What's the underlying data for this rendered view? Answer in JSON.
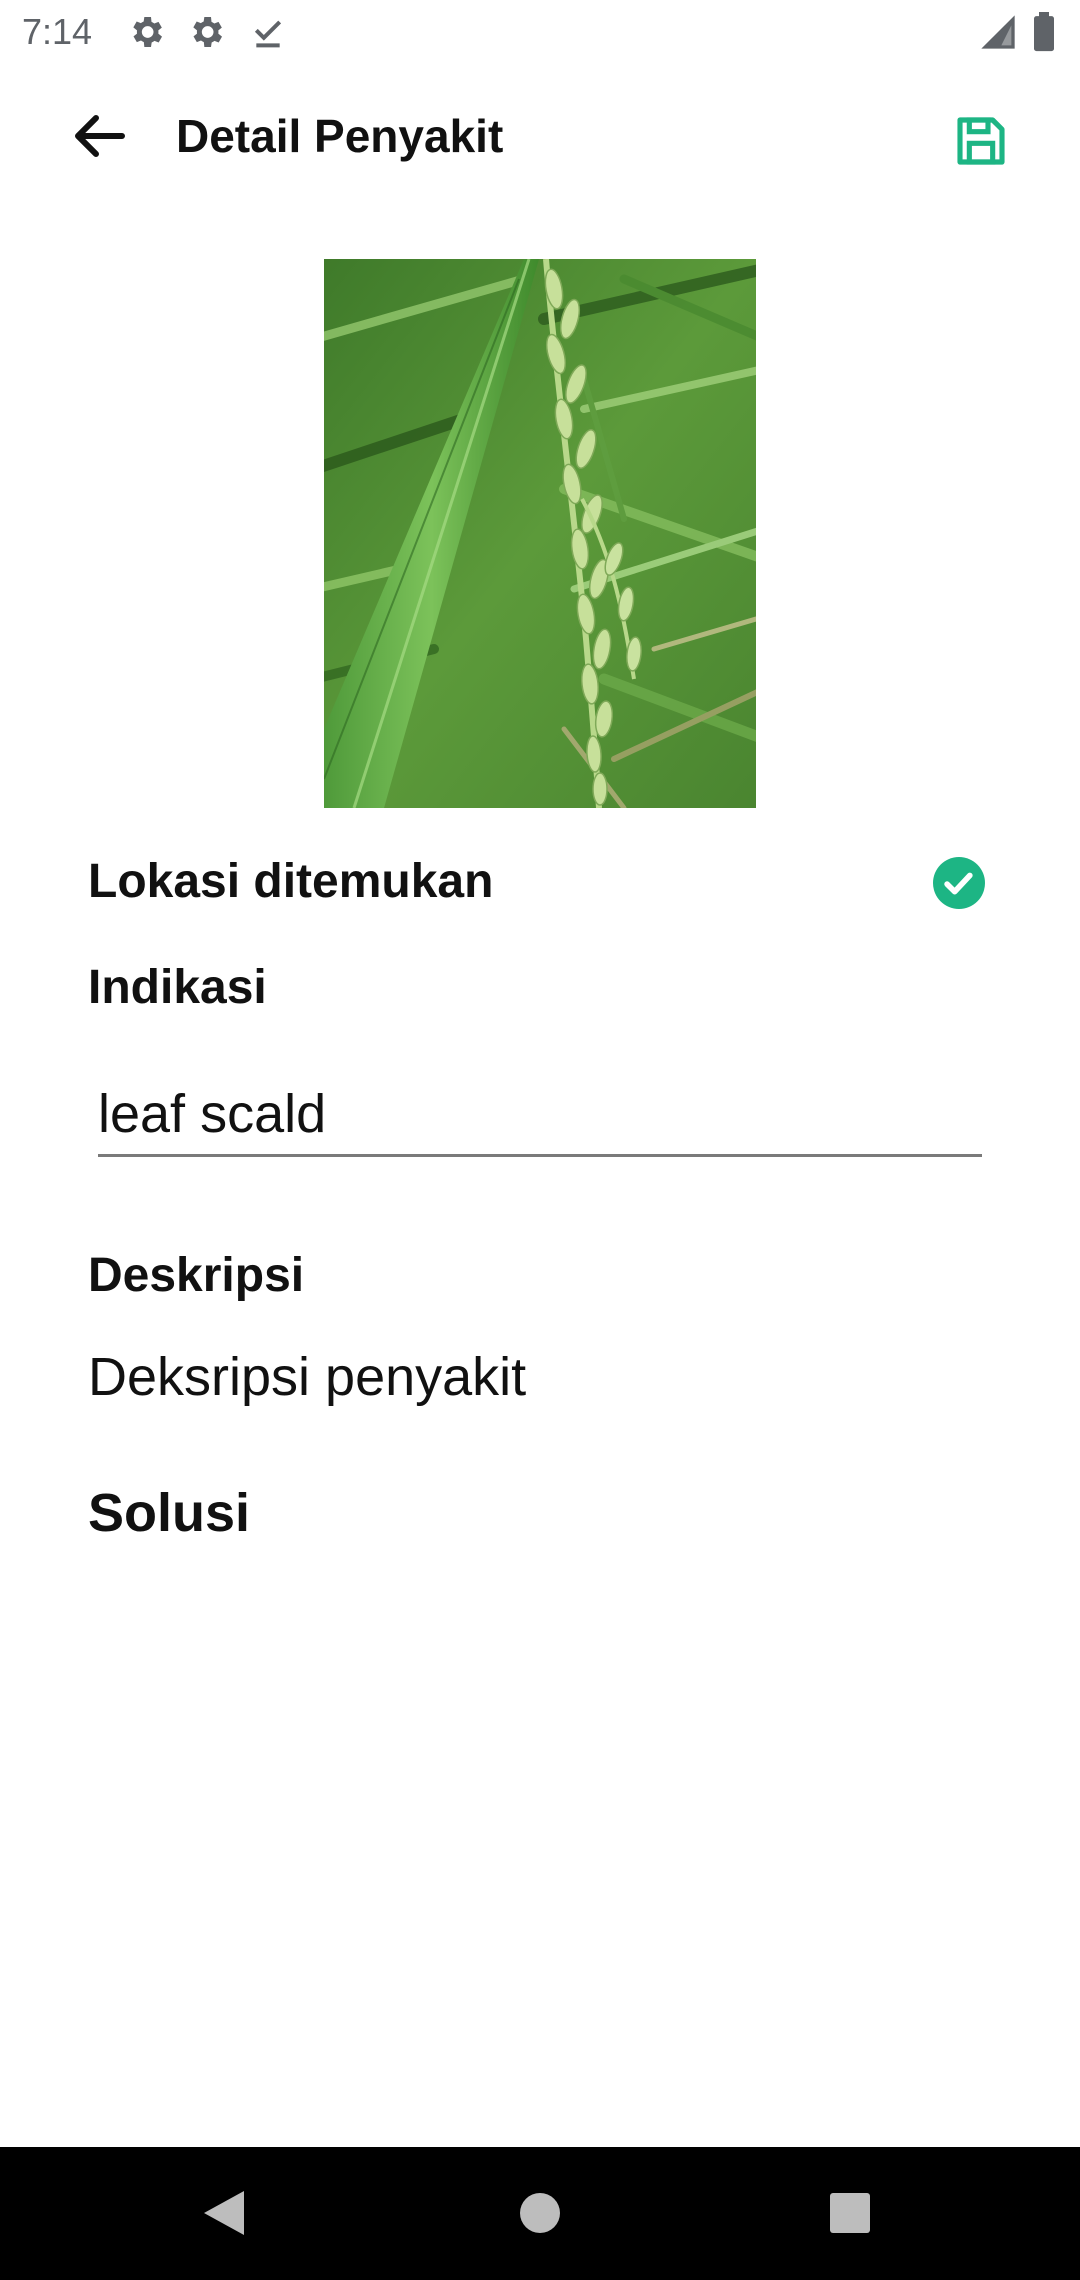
{
  "status_bar": {
    "time": "7:14"
  },
  "app_bar": {
    "title": "Detail Penyakit",
    "back_icon": "arrow-left-icon",
    "save_icon": "floppy-disk-icon",
    "accent_color": "#1db584"
  },
  "detail": {
    "location_label": "Lokasi ditemukan",
    "location_status_icon": "check-circle-icon",
    "indikasi_label": "Indikasi",
    "indikasi_value": "leaf scald",
    "deskripsi_label": "Deskripsi",
    "deskripsi_value": "Deksripsi penyakit",
    "solusi_label": "Solusi"
  },
  "nav_bar": {
    "back_icon": "triangle-back-icon",
    "home_icon": "circle-home-icon",
    "recents_icon": "square-recents-icon"
  }
}
